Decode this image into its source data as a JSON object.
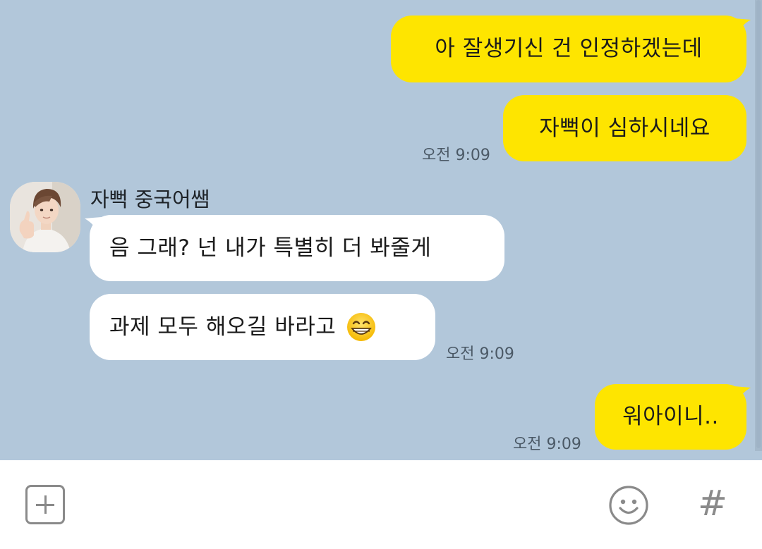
{
  "messages": [
    {
      "id": "m1",
      "from": "me",
      "text": "아 잘생기신 건 인정하겠는데"
    },
    {
      "id": "m2",
      "from": "me",
      "text": "자뻑이 심하시네요",
      "time": "오전 9:09"
    },
    {
      "id": "m3",
      "from": "them",
      "sender": "자뻑 중국어쌤",
      "text": "음 그래? 넌 내가 특별히 더 봐줄게"
    },
    {
      "id": "m4",
      "from": "them",
      "text": "과제 모두 해오길 바라고",
      "emoji": "grinning-face-emoji",
      "time": "오전 9:09"
    },
    {
      "id": "m5",
      "from": "me",
      "text": "워아이니..",
      "time": "오전 9:09"
    }
  ],
  "composer": {
    "attach_icon": "plus-square-icon",
    "emoji_icon": "smiley-icon",
    "hash_icon": "hash-icon",
    "hash_glyph": "#"
  },
  "colors": {
    "background": "#b2c7da",
    "my_bubble": "#fee500",
    "their_bubble": "#ffffff",
    "composer_bg": "#ffffff",
    "icon_gray": "#8a8a8a"
  }
}
